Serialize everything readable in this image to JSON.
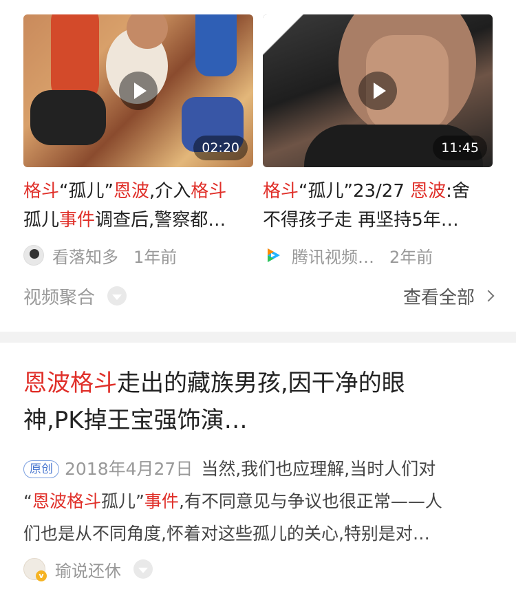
{
  "videos": [
    {
      "duration": "02:20",
      "title_line1": [
        {
          "t": "格斗",
          "hl": true
        },
        {
          "t": "“孤儿”",
          "hl": false
        },
        {
          "t": "恩波",
          "hl": true
        },
        {
          "t": ",介入",
          "hl": false
        },
        {
          "t": "格斗",
          "hl": true
        }
      ],
      "title_line2": [
        {
          "t": "孤儿",
          "hl": false
        },
        {
          "t": "事件",
          "hl": true
        },
        {
          "t": "调查后,警察都…",
          "hl": false
        }
      ],
      "source": "看落知多",
      "time": "1年前"
    },
    {
      "duration": "11:45",
      "title_line1": [
        {
          "t": "格斗",
          "hl": true
        },
        {
          "t": "“孤儿”23/27 ",
          "hl": false
        },
        {
          "t": "恩波",
          "hl": true
        },
        {
          "t": ":舍",
          "hl": false
        }
      ],
      "title_line2": [
        {
          "t": "不得孩子走 再坚持5年…",
          "hl": false
        }
      ],
      "source": "腾讯视频…",
      "time": "2年前"
    }
  ],
  "aggregate": {
    "label": "视频聚合",
    "view_all": "查看全部"
  },
  "article": {
    "title_line1": [
      {
        "t": "恩波格斗",
        "hl": true
      },
      {
        "t": "走出的藏族男孩,因干净的眼",
        "hl": false
      }
    ],
    "title_line2": "神,PK掉王宝强饰演…",
    "badge": "原创",
    "date": "2018年4月27日",
    "body_line1": "当然,我们也应理解,当时人们对",
    "body_line2": [
      {
        "t": "“",
        "hl": false
      },
      {
        "t": "恩波格斗",
        "hl": true
      },
      {
        "t": "孤儿”",
        "hl": false
      },
      {
        "t": "事件",
        "hl": true
      },
      {
        "t": ",有不同意见与争议也很正常——人",
        "hl": false
      }
    ],
    "body_line3": "们也是从不同角度,怀着对这些孤儿的关心,特别是对…",
    "author": "瑜说还休"
  },
  "colors": {
    "highlight": "#e0302a",
    "meta_gray": "#999999",
    "badge_blue": "#4a78d0"
  },
  "icons": [
    "play-icon",
    "chevron-down-icon",
    "chevron-right-icon",
    "tencent-video-logo",
    "verified-v-icon"
  ]
}
